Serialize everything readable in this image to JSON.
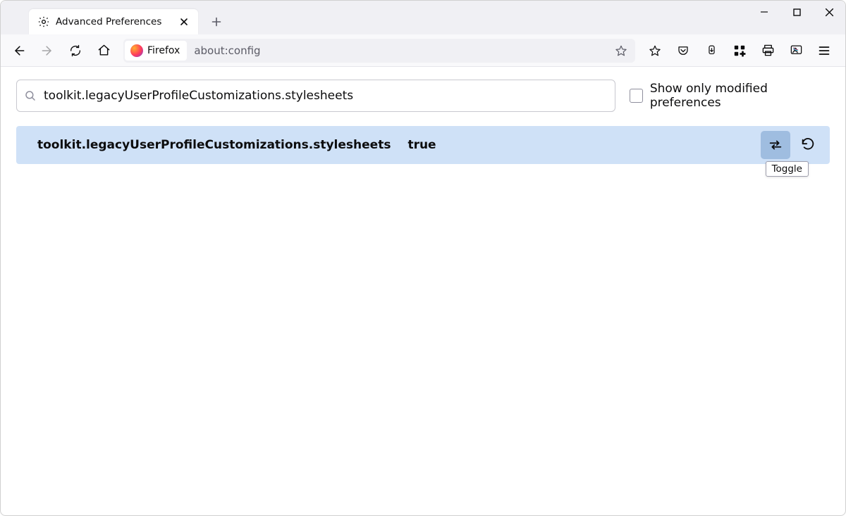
{
  "tab": {
    "title": "Advanced Preferences"
  },
  "urlbar": {
    "identity_label": "Firefox",
    "url": "about:config"
  },
  "about_config": {
    "search_value": "toolkit.legacyUserProfileCustomizations.stylesheets",
    "show_only_modified_label": "Show only modified preferences",
    "show_only_modified_checked": false,
    "result": {
      "name": "toolkit.legacyUserProfileCustomizations.stylesheets",
      "value": "true",
      "toggle_tooltip": "Toggle"
    }
  }
}
